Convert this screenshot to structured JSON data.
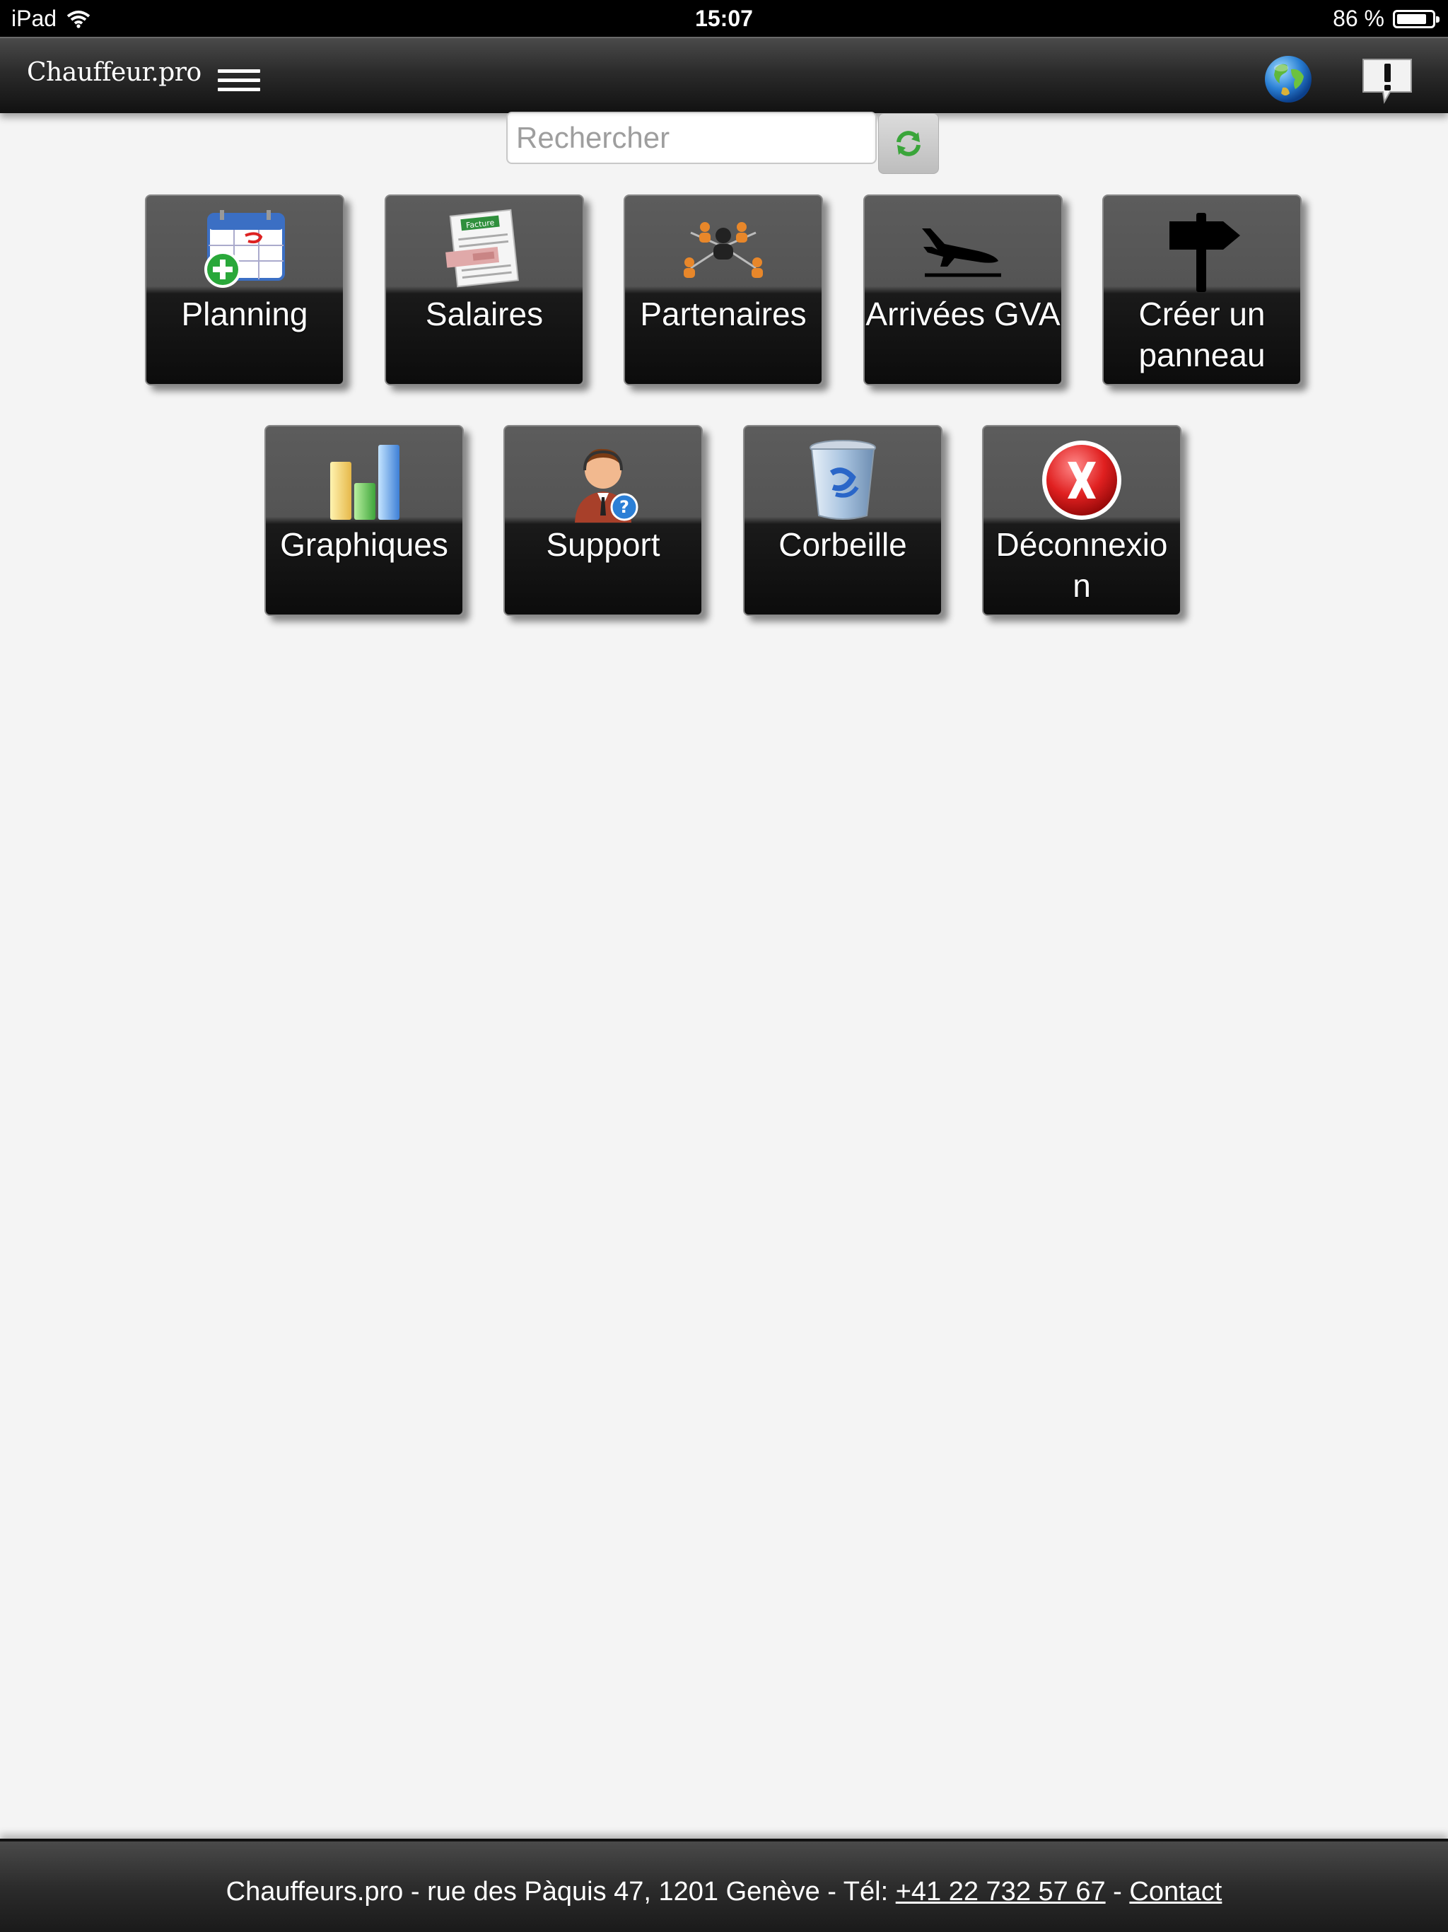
{
  "status_bar": {
    "device": "iPad",
    "time": "15:07",
    "battery_text": "86 %",
    "battery_level": 0.86
  },
  "header": {
    "brand": "Chauffeur.pro",
    "menu_icon": "hamburger-icon",
    "globe_icon": "globe-icon",
    "alert_icon": "exclamation-bubble-icon"
  },
  "search": {
    "placeholder": "Rechercher",
    "value": "",
    "refresh_icon": "refresh-icon"
  },
  "tiles": [
    {
      "label": "Planning",
      "icon": "calendar-add-icon"
    },
    {
      "label": "Salaires",
      "icon": "invoice-icon"
    },
    {
      "label": "Partenaires",
      "icon": "network-people-icon"
    },
    {
      "label": "Arrivées GVA",
      "icon": "plane-landing-icon"
    },
    {
      "label": "Créer un panneau",
      "icon": "signpost-icon"
    },
    {
      "label": "Graphiques",
      "icon": "bar-chart-icon"
    },
    {
      "label": "Support",
      "icon": "support-agent-icon"
    },
    {
      "label": "Corbeille",
      "icon": "trash-bin-icon"
    },
    {
      "label": "Déconnexion",
      "icon": "logout-x-icon"
    }
  ],
  "footer": {
    "text": "Chauffeurs.pro - rue des Pàquis 47, 1201 Genève - Tél: ",
    "phone": "+41 22 732 57 67",
    "separator": " - ",
    "contact": "Contact"
  },
  "colors": {
    "header_bg": "#2b2b2b",
    "page_bg": "#f4f4f4",
    "tile_top": "#5c5c5c",
    "tile_bottom": "#0c0c0c"
  }
}
